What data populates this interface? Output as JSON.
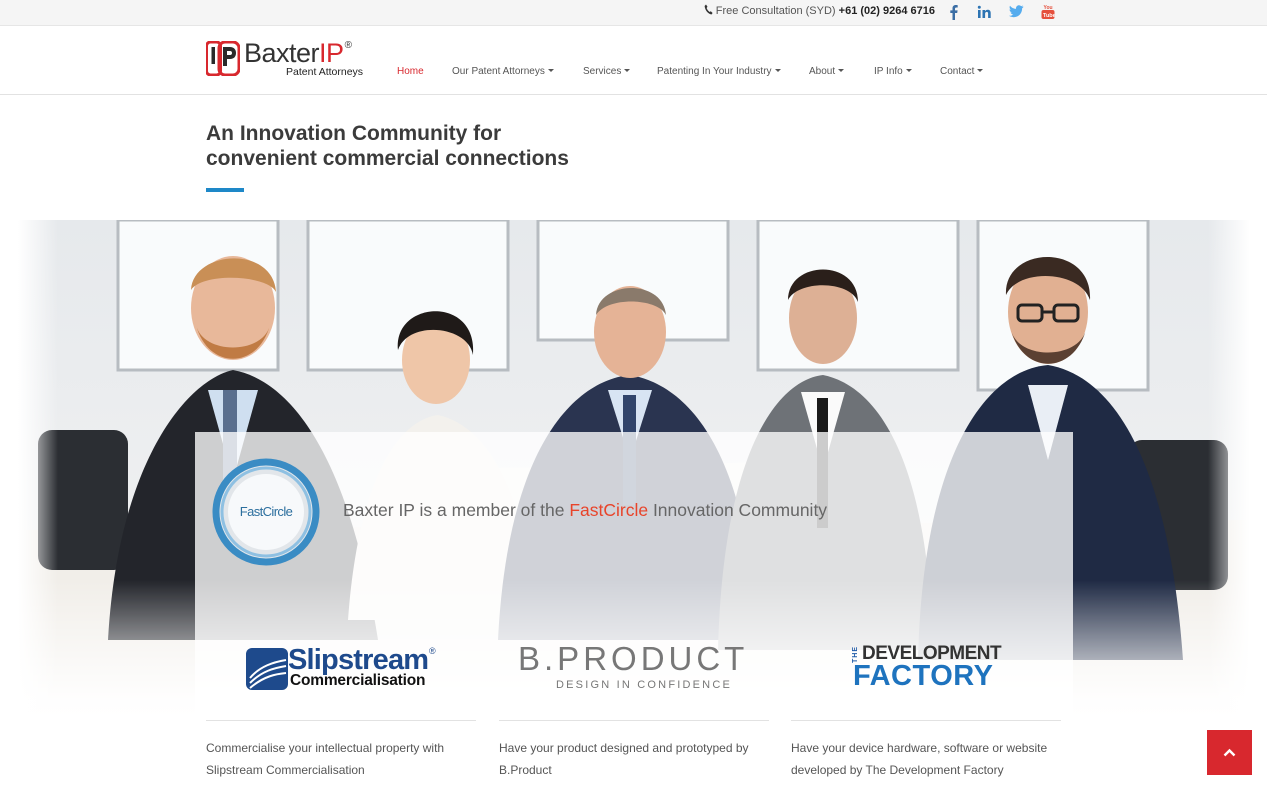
{
  "topbar": {
    "consultation_label": "Free Consultation (SYD)",
    "phone": "+61 (02) 9264 6716",
    "social": [
      "facebook-icon",
      "linkedin-icon",
      "twitter-icon",
      "youtube-icon"
    ]
  },
  "logo": {
    "brand_first": "Baxter",
    "brand_ip": "IP",
    "registered": "®",
    "tagline": "Patent Attorneys",
    "mark_letters": "IP"
  },
  "nav": {
    "items": [
      {
        "label": "Home",
        "active": true,
        "dropdown": false
      },
      {
        "label": "Our Patent Attorneys",
        "active": false,
        "dropdown": true
      },
      {
        "label": "Services",
        "active": false,
        "dropdown": true
      },
      {
        "label": "Patenting In Your Industry",
        "active": false,
        "dropdown": true
      },
      {
        "label": "About",
        "active": false,
        "dropdown": true
      },
      {
        "label": "IP Info",
        "active": false,
        "dropdown": true
      },
      {
        "label": "Contact",
        "active": false,
        "dropdown": true
      }
    ]
  },
  "heading": {
    "line1": "An Innovation Community for",
    "line2": "convenient commercial connections"
  },
  "fastcircle": {
    "badge_text": "FastCircle",
    "member_prefix": "Baxter IP is a member of the ",
    "member_highlight": "FastCircle",
    "member_suffix": " Innovation Community"
  },
  "partners": [
    {
      "logo_line1": "Slipstream",
      "logo_reg": "®",
      "logo_line2": "Commercialisation",
      "description": "Commercialise your intellectual property with Slipstream Commercialisation"
    },
    {
      "logo_line1": "B.PRODUCT",
      "logo_line2": "DESIGN IN CONFIDENCE",
      "description": "Have your product designed and prototyped by B.Product"
    },
    {
      "logo_the": "THE",
      "logo_line1": "DEVELOPMENT",
      "logo_line2": "FACTORY",
      "description": "Have your device hardware, software or website developed by The Development Factory"
    }
  ],
  "colors": {
    "brand_red": "#d8282e",
    "accent_blue": "#1e88c8",
    "fastcircle_orange": "#e8442a"
  },
  "back_to_top_icon": "chevron-up-icon"
}
